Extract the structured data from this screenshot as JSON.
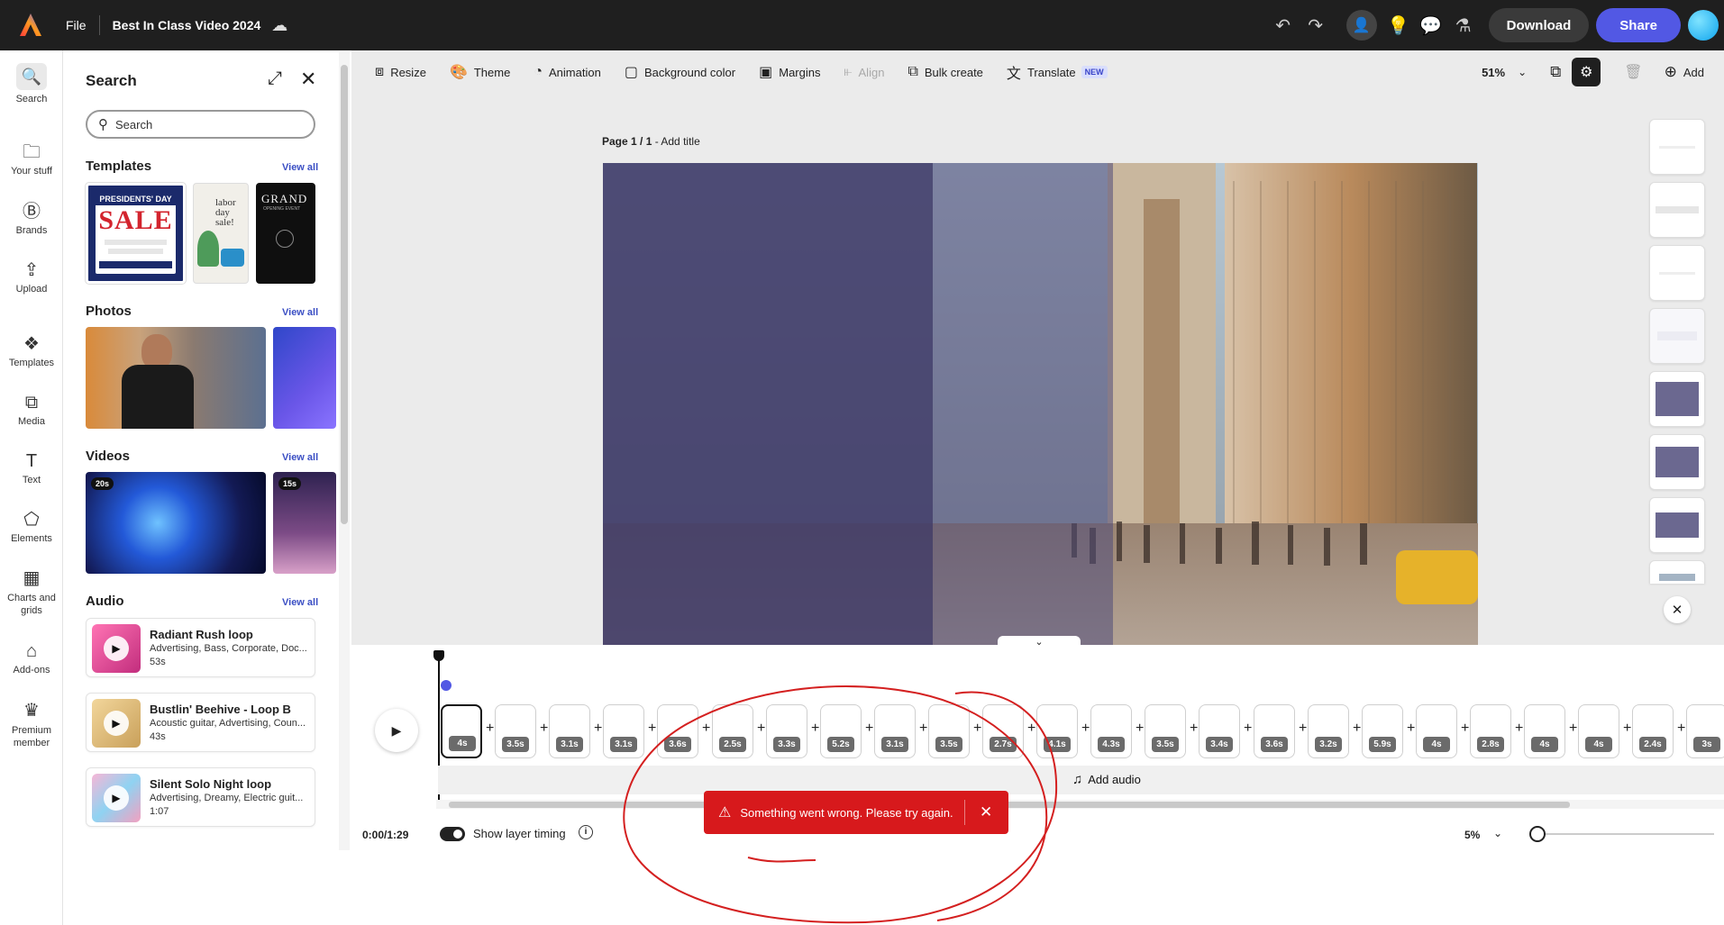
{
  "topbar": {
    "file_label": "File",
    "doc_title": "Best In Class Video 2024",
    "download_label": "Download",
    "share_label": "Share"
  },
  "rail": [
    {
      "label": "Search",
      "icon": "search-icon"
    },
    {
      "label": "Your stuff",
      "icon": "folder-icon"
    },
    {
      "label": "Brands",
      "icon": "brand-icon"
    },
    {
      "label": "Upload",
      "icon": "upload-icon"
    },
    {
      "label": "Templates",
      "icon": "templates-icon"
    },
    {
      "label": "Media",
      "icon": "media-icon"
    },
    {
      "label": "Text",
      "icon": "text-icon"
    },
    {
      "label": "Elements",
      "icon": "elements-icon"
    },
    {
      "label": "Charts and grids",
      "icon": "charts-icon"
    },
    {
      "label": "Add-ons",
      "icon": "addons-icon"
    },
    {
      "label": "Premium member",
      "icon": "crown-icon"
    }
  ],
  "panel": {
    "title": "Search",
    "search_placeholder": "Search",
    "templates_title": "Templates",
    "photos_title": "Photos",
    "videos_title": "Videos",
    "audio_title": "Audio",
    "view_all": "View all",
    "template_texts": {
      "t1_line1": "PRESIDENTS' DAY",
      "t1_line2": "SALE",
      "t2_line1": "labor",
      "t2_line2": "day sale!",
      "t3_line1": "GRAND",
      "t3_line2": "OPENING EVENT"
    },
    "video_badges": [
      "20s",
      "15s"
    ],
    "audio": [
      {
        "title": "Radiant Rush loop",
        "tags": "Advertising, Bass, Corporate, Doc...",
        "duration": "53s"
      },
      {
        "title": "Bustlin' Beehive - Loop B",
        "tags": "Acoustic guitar, Advertising, Coun...",
        "duration": "43s"
      },
      {
        "title": "Silent Solo Night loop",
        "tags": "Advertising, Dreamy, Electric guit...",
        "duration": "1:07"
      }
    ]
  },
  "toolbar": {
    "resize": "Resize",
    "theme": "Theme",
    "animation": "Animation",
    "background_color": "Background color",
    "margins": "Margins",
    "align": "Align",
    "bulk_create": "Bulk create",
    "translate": "Translate",
    "new_badge": "NEW",
    "zoom": "51%",
    "add": "Add"
  },
  "page": {
    "label_bold": "Page 1 / 1",
    "label_rest": " - Add title"
  },
  "timeline": {
    "durations": [
      "4s",
      "3.5s",
      "3.1s",
      "3.1s",
      "3.6s",
      "2.5s",
      "3.3s",
      "5.2s",
      "3.1s",
      "3.5s",
      "2.7s",
      "4.1s",
      "4.3s",
      "3.5s",
      "3.4s",
      "3.6s",
      "3.2s",
      "5.9s",
      "4s",
      "2.8s",
      "4s",
      "4s",
      "2.4s",
      "3s"
    ],
    "add_audio": "Add audio",
    "time": "0:00/1:29",
    "show_layer_timing": "Show layer timing",
    "zoom": "5%"
  },
  "toast": {
    "message": "Something went wrong. Please try again."
  }
}
